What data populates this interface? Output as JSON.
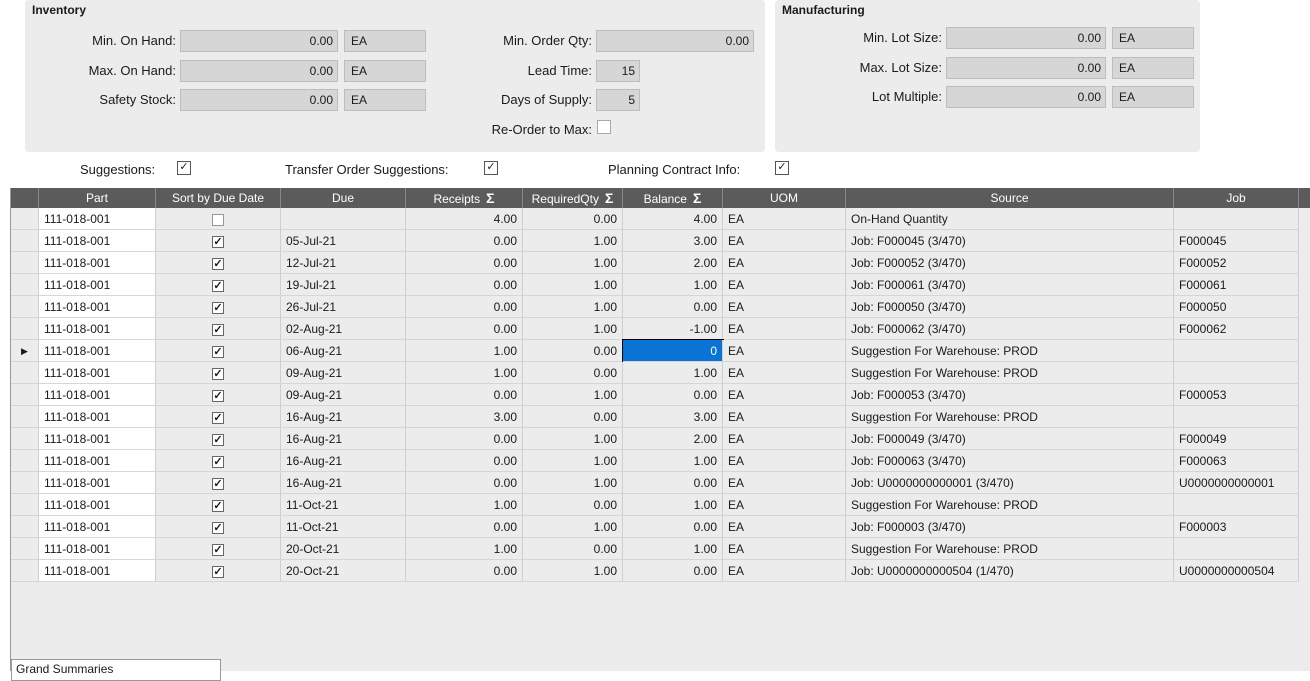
{
  "inventory": {
    "title": "Inventory",
    "min_on_hand": {
      "label": "Min. On Hand:",
      "value": "0.00",
      "uom": "EA"
    },
    "max_on_hand": {
      "label": "Max. On Hand:",
      "value": "0.00",
      "uom": "EA"
    },
    "safety_stock": {
      "label": "Safety Stock:",
      "value": "0.00",
      "uom": "EA"
    },
    "min_order_qty": {
      "label": "Min. Order Qty:",
      "value": "0.00"
    },
    "lead_time": {
      "label": "Lead Time:",
      "value": "15"
    },
    "days_of_supply": {
      "label": "Days of Supply:",
      "value": "5"
    },
    "reorder_to_max": {
      "label": "Re-Order to Max:",
      "checked": false
    }
  },
  "manufacturing": {
    "title": "Manufacturing",
    "min_lot_size": {
      "label": "Min. Lot Size:",
      "value": "0.00",
      "uom": "EA"
    },
    "max_lot_size": {
      "label": "Max. Lot Size:",
      "value": "0.00",
      "uom": "EA"
    },
    "lot_multiple": {
      "label": "Lot Multiple:",
      "value": "0.00",
      "uom": "EA"
    }
  },
  "options": {
    "suggestions": {
      "label": "Suggestions:",
      "checked": true
    },
    "transfer_order_suggestions": {
      "label": "Transfer Order Suggestions:",
      "checked": true
    },
    "planning_contract_info": {
      "label": "Planning Contract Info:",
      "checked": true
    }
  },
  "grid": {
    "columns": [
      "Part",
      "Sort by Due Date",
      "Due",
      "Receipts",
      "RequiredQty",
      "Balance",
      "UOM",
      "Source",
      "Job"
    ],
    "sigma_columns": [
      "Receipts",
      "RequiredQty",
      "Balance"
    ],
    "sigma_glyph": "Σ",
    "current_row_indicator": "▶",
    "rows": [
      {
        "part": "111-018-001",
        "sort": false,
        "due": "",
        "receipts": "4.00",
        "required": "0.00",
        "balance": "4.00",
        "uom": "EA",
        "source": "On-Hand Quantity",
        "job": ""
      },
      {
        "part": "111-018-001",
        "sort": true,
        "due": "05-Jul-21",
        "receipts": "0.00",
        "required": "1.00",
        "balance": "3.00",
        "uom": "EA",
        "source": "Job: F000045 (3/470)",
        "job": "F000045"
      },
      {
        "part": "111-018-001",
        "sort": true,
        "due": "12-Jul-21",
        "receipts": "0.00",
        "required": "1.00",
        "balance": "2.00",
        "uom": "EA",
        "source": "Job: F000052 (3/470)",
        "job": "F000052"
      },
      {
        "part": "111-018-001",
        "sort": true,
        "due": "19-Jul-21",
        "receipts": "0.00",
        "required": "1.00",
        "balance": "1.00",
        "uom": "EA",
        "source": "Job: F000061 (3/470)",
        "job": "F000061"
      },
      {
        "part": "111-018-001",
        "sort": true,
        "due": "26-Jul-21",
        "receipts": "0.00",
        "required": "1.00",
        "balance": "0.00",
        "uom": "EA",
        "source": "Job: F000050 (3/470)",
        "job": "F000050"
      },
      {
        "part": "111-018-001",
        "sort": true,
        "due": "02-Aug-21",
        "receipts": "0.00",
        "required": "1.00",
        "balance": "-1.00",
        "uom": "EA",
        "source": "Job: F000062 (3/470)",
        "job": "F000062"
      },
      {
        "part": "111-018-001",
        "sort": true,
        "due": "06-Aug-21",
        "receipts": "1.00",
        "required": "0.00",
        "balance": "0",
        "uom": "EA",
        "source": "Suggestion For Warehouse: PROD",
        "job": "",
        "current": true
      },
      {
        "part": "111-018-001",
        "sort": true,
        "due": "09-Aug-21",
        "receipts": "1.00",
        "required": "0.00",
        "balance": "1.00",
        "uom": "EA",
        "source": "Suggestion For Warehouse: PROD",
        "job": ""
      },
      {
        "part": "111-018-001",
        "sort": true,
        "due": "09-Aug-21",
        "receipts": "0.00",
        "required": "1.00",
        "balance": "0.00",
        "uom": "EA",
        "source": "Job: F000053 (3/470)",
        "job": "F000053"
      },
      {
        "part": "111-018-001",
        "sort": true,
        "due": "16-Aug-21",
        "receipts": "3.00",
        "required": "0.00",
        "balance": "3.00",
        "uom": "EA",
        "source": "Suggestion For Warehouse: PROD",
        "job": ""
      },
      {
        "part": "111-018-001",
        "sort": true,
        "due": "16-Aug-21",
        "receipts": "0.00",
        "required": "1.00",
        "balance": "2.00",
        "uom": "EA",
        "source": "Job: F000049 (3/470)",
        "job": "F000049"
      },
      {
        "part": "111-018-001",
        "sort": true,
        "due": "16-Aug-21",
        "receipts": "0.00",
        "required": "1.00",
        "balance": "1.00",
        "uom": "EA",
        "source": "Job: F000063 (3/470)",
        "job": "F000063"
      },
      {
        "part": "111-018-001",
        "sort": true,
        "due": "16-Aug-21",
        "receipts": "0.00",
        "required": "1.00",
        "balance": "0.00",
        "uom": "EA",
        "source": "Job: U0000000000001 (3/470)",
        "job": "U0000000000001"
      },
      {
        "part": "111-018-001",
        "sort": true,
        "due": "11-Oct-21",
        "receipts": "1.00",
        "required": "0.00",
        "balance": "1.00",
        "uom": "EA",
        "source": "Suggestion For Warehouse: PROD",
        "job": ""
      },
      {
        "part": "111-018-001",
        "sort": true,
        "due": "11-Oct-21",
        "receipts": "0.00",
        "required": "1.00",
        "balance": "0.00",
        "uom": "EA",
        "source": "Job: F000003 (3/470)",
        "job": "F000003"
      },
      {
        "part": "111-018-001",
        "sort": true,
        "due": "20-Oct-21",
        "receipts": "1.00",
        "required": "0.00",
        "balance": "1.00",
        "uom": "EA",
        "source": "Suggestion For Warehouse: PROD",
        "job": ""
      },
      {
        "part": "111-018-001",
        "sort": true,
        "due": "20-Oct-21",
        "receipts": "0.00",
        "required": "1.00",
        "balance": "0.00",
        "uom": "EA",
        "source": "Job: U0000000000504 (1/470)",
        "job": "U0000000000504"
      }
    ],
    "footer": "Grand Summaries"
  }
}
